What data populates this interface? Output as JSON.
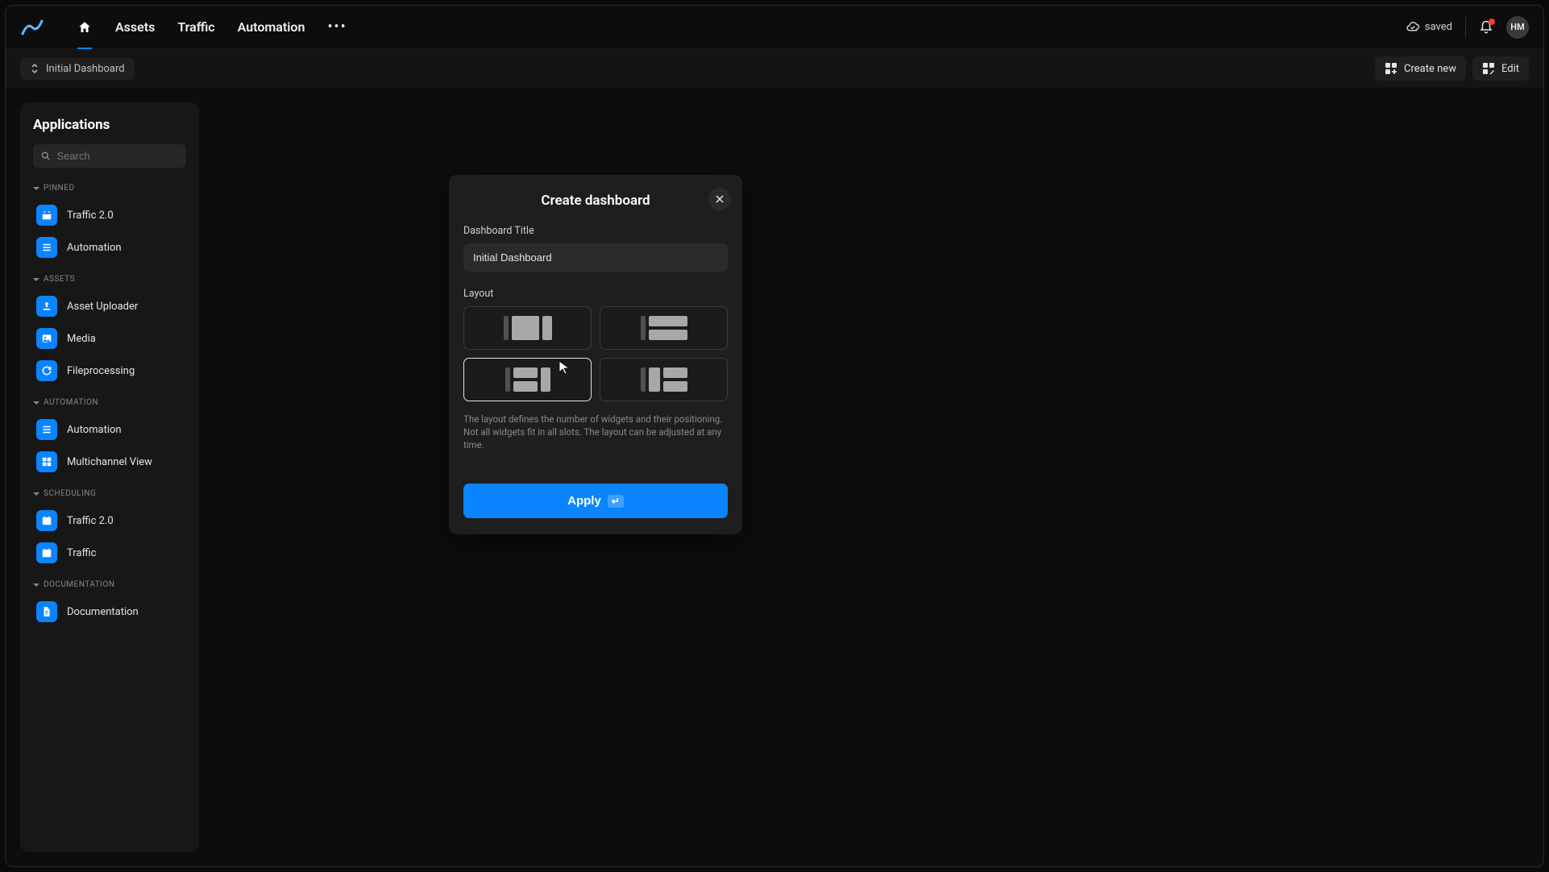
{
  "nav": {
    "items": [
      "Assets",
      "Traffic",
      "Automation"
    ],
    "save_status": "saved",
    "avatar": "HM"
  },
  "subnav": {
    "crumb": "Initial Dashboard",
    "create_new": "Create new",
    "edit": "Edit"
  },
  "sidebar": {
    "title": "Applications",
    "search_placeholder": "Search",
    "sections": [
      {
        "title": "PINNED",
        "items": [
          {
            "label": "Traffic 2.0",
            "icon": "calendar"
          },
          {
            "label": "Automation",
            "icon": "list"
          }
        ]
      },
      {
        "title": "ASSETS",
        "items": [
          {
            "label": "Asset Uploader",
            "icon": "upload"
          },
          {
            "label": "Media",
            "icon": "image"
          },
          {
            "label": "Fileprocessing",
            "icon": "refresh"
          }
        ]
      },
      {
        "title": "AUTOMATION",
        "items": [
          {
            "label": "Automation",
            "icon": "list"
          },
          {
            "label": "Multichannel View",
            "icon": "grid"
          }
        ]
      },
      {
        "title": "SCHEDULING",
        "items": [
          {
            "label": "Traffic 2.0",
            "icon": "calendar"
          },
          {
            "label": "Traffic",
            "icon": "calendar"
          }
        ]
      },
      {
        "title": "DOCUMENTATION",
        "items": [
          {
            "label": "Documentation",
            "icon": "doc"
          }
        ]
      }
    ]
  },
  "modal": {
    "title": "Create dashboard",
    "field_title_label": "Dashboard Title",
    "field_title_value": "Initial Dashboard",
    "layout_label": "Layout",
    "helper": "The layout defines the number of widgets and their positioning. Not all widgets fit in all slots. The layout can be adjusted at any time.",
    "apply": "Apply",
    "selected_layout_index": 2
  },
  "colors": {
    "accent": "#0a84ff",
    "danger": "#ff3b30"
  }
}
